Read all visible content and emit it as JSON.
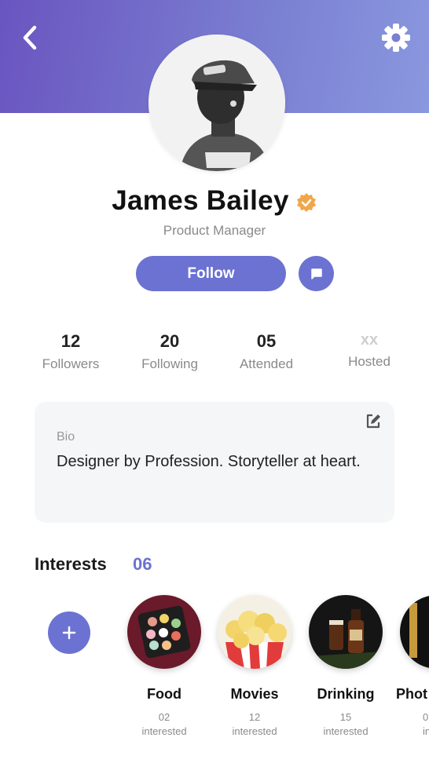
{
  "header": {
    "back_icon": "chevron-left-icon",
    "settings_icon": "gear-icon",
    "gradient_start": "#6a55c0",
    "gradient_end": "#8a98df"
  },
  "profile": {
    "name": "James Bailey",
    "role": "Product Manager",
    "verified_badge_color": "#f0a64a",
    "follow_label": "Follow",
    "message_icon": "message-icon",
    "accent": "#6b72d2"
  },
  "stats": [
    {
      "value": "12",
      "label": "Followers"
    },
    {
      "value": "20",
      "label": "Following"
    },
    {
      "value": "05",
      "label": "Attended"
    },
    {
      "value": "xx",
      "label": "Hosted"
    }
  ],
  "bio": {
    "title": "Bio",
    "text": "Designer by Profession. Storyteller at heart.",
    "edit_icon": "edit-icon"
  },
  "interests": {
    "title": "Interests",
    "count": "06",
    "add_icon": "plus-icon",
    "items": [
      {
        "name": "Food",
        "count": "02",
        "count_label": "interested"
      },
      {
        "name": "Movies",
        "count": "12",
        "count_label": "interested"
      },
      {
        "name": "Drinking",
        "count": "15",
        "count_label": "interested"
      },
      {
        "name": "Phot",
        "count": "0",
        "count_label": "intere"
      }
    ]
  }
}
